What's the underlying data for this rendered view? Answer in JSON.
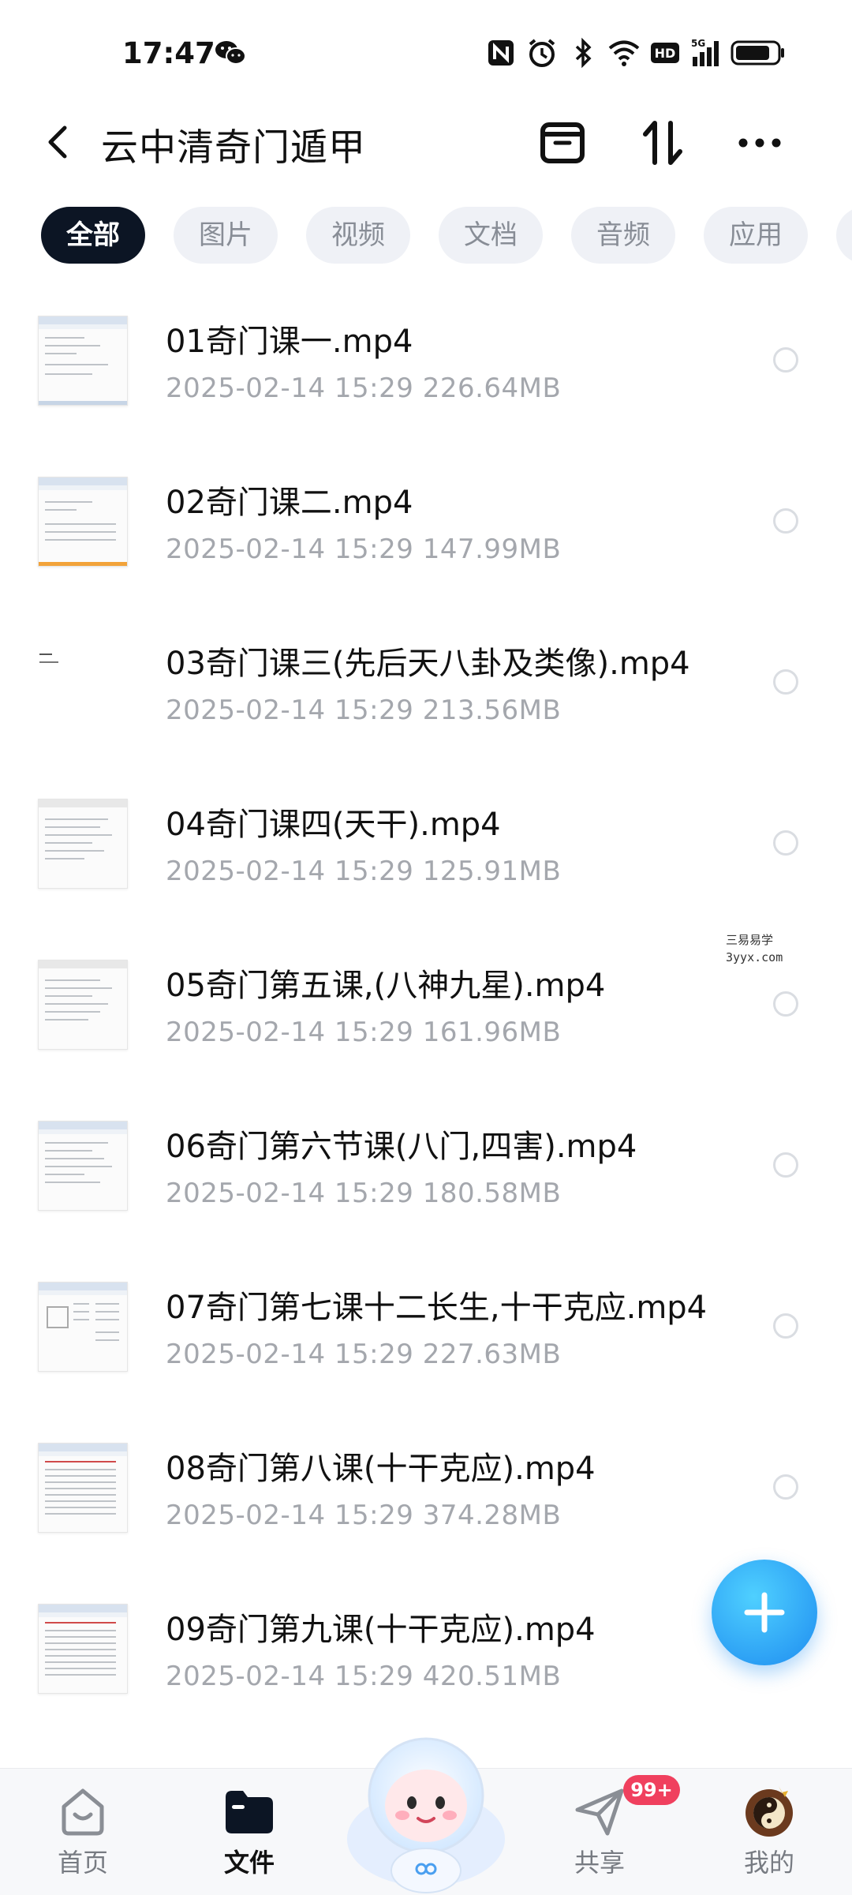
{
  "status_bar": {
    "time": "17:47",
    "network": "5G",
    "hd": "HD",
    "icons": [
      "wechat-icon",
      "nfc-icon",
      "alarm-icon",
      "bluetooth-icon",
      "wifi-icon",
      "hd-icon",
      "signal-icon",
      "battery-icon"
    ]
  },
  "header": {
    "title": "云中清奇门遁甲",
    "icons": [
      "back-icon",
      "archive-icon",
      "sort-icon",
      "more-icon"
    ]
  },
  "tabs": [
    {
      "label": "全部",
      "active": true
    },
    {
      "label": "图片"
    },
    {
      "label": "视频"
    },
    {
      "label": "文档"
    },
    {
      "label": "音频"
    },
    {
      "label": "应用"
    }
  ],
  "files": [
    {
      "name": "01奇门课一.mp4",
      "date": "2025-02-14",
      "time": "15:29",
      "size": "226.64MB"
    },
    {
      "name": "02奇门课二.mp4",
      "date": "2025-02-14",
      "time": "15:29",
      "size": "147.99MB"
    },
    {
      "name": "03奇门课三(先后天八卦及类像).mp4",
      "date": "2025-02-14",
      "time": "15:29",
      "size": "213.56MB"
    },
    {
      "name": "04奇门课四(天干).mp4",
      "date": "2025-02-14",
      "time": "15:29",
      "size": "125.91MB"
    },
    {
      "name": "05奇门第五课,(八神九星).mp4",
      "date": "2025-02-14",
      "time": "15:29",
      "size": "161.96MB"
    },
    {
      "name": "06奇门第六节课(八门,四害).mp4",
      "date": "2025-02-14",
      "time": "15:29",
      "size": "180.58MB"
    },
    {
      "name": "07奇门第七课十二长生,十干克应.mp4",
      "date": "2025-02-14",
      "time": "15:29",
      "size": "227.63MB"
    },
    {
      "name": "08奇门第八课(十干克应).mp4",
      "date": "2025-02-14",
      "time": "15:29",
      "size": "374.28MB"
    },
    {
      "name": "09奇门第九课(十干克应).mp4",
      "date": "2025-02-14",
      "time": "15:29",
      "size": "420.51MB"
    }
  ],
  "watermark": {
    "line1": "三易易学",
    "line2": "3yyx.com"
  },
  "fab": {
    "icon": "plus-icon"
  },
  "bottom_nav": {
    "items": [
      {
        "label": "首页",
        "icon": "home-icon"
      },
      {
        "label": "文件",
        "icon": "folder-icon",
        "active": true
      },
      {
        "label": "共享",
        "icon": "paper-plane-icon",
        "badge": "99+"
      },
      {
        "label": "我的",
        "icon": "avatar-icon"
      }
    ]
  },
  "colors": {
    "accent": "#1e8cf0",
    "active_tab": "#0c1524",
    "badge": "#f0405e",
    "meta_text": "#a4a7ad"
  }
}
